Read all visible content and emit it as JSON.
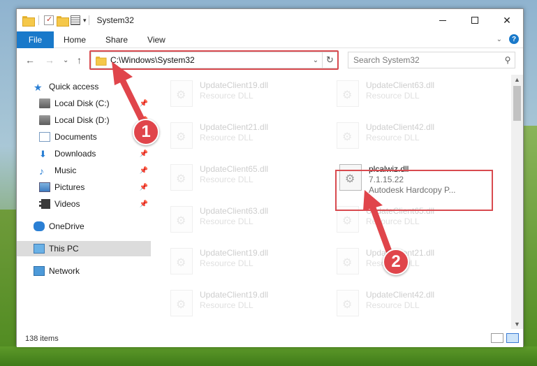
{
  "window": {
    "title": "System32"
  },
  "ribbon": {
    "tabs": [
      "File",
      "Home",
      "Share",
      "View"
    ]
  },
  "address": {
    "path": "C:\\Windows\\System32"
  },
  "search": {
    "placeholder": "Search System32"
  },
  "nav": {
    "items": [
      {
        "label": "Quick access",
        "icon": "star-icon"
      },
      {
        "label": "Local Disk (C:)",
        "icon": "disk-icon",
        "pinned": true
      },
      {
        "label": "Local Disk (D:)",
        "icon": "disk-icon",
        "pinned": true
      },
      {
        "label": "Documents",
        "icon": "documents-icon",
        "pinned": true
      },
      {
        "label": "Downloads",
        "icon": "downloads-icon",
        "pinned": true
      },
      {
        "label": "Music",
        "icon": "music-icon",
        "pinned": true
      },
      {
        "label": "Pictures",
        "icon": "pictures-icon",
        "pinned": true
      },
      {
        "label": "Videos",
        "icon": "videos-icon",
        "pinned": true
      },
      {
        "label": "OneDrive",
        "icon": "onedrive-icon"
      },
      {
        "label": "This PC",
        "icon": "this-pc-icon",
        "selected": true
      },
      {
        "label": "Network",
        "icon": "network-icon"
      }
    ]
  },
  "files": [
    {
      "name": "UpdateClient19.dll",
      "sub": "Resource DLL",
      "faded": true
    },
    {
      "name": "UpdateClient63.dll",
      "sub": "Resource DLL",
      "faded": true
    },
    {
      "name": "UpdateClient21.dll",
      "sub": "Resource DLL",
      "faded": true
    },
    {
      "name": "UpdateClient42.dll",
      "sub": "Resource DLL",
      "faded": true
    },
    {
      "name": "UpdateClient65.dll",
      "sub": "Resource DLL",
      "faded": true
    },
    {
      "name": "plcalwiz.dll",
      "sub": "7.1.15.22",
      "sub2": "Autodesk Hardcopy P...",
      "faded": false
    },
    {
      "name": "UpdateClient63.dll",
      "sub": "Resource DLL",
      "faded": true
    },
    {
      "name": "UpdateClient65.dll",
      "sub": "Resource DLL",
      "faded": true
    },
    {
      "name": "UpdateClient19.dll",
      "sub": "Resource DLL",
      "faded": true
    },
    {
      "name": "UpdateClient21.dll",
      "sub": "Resource DLL",
      "faded": true
    },
    {
      "name": "UpdateClient19.dll",
      "sub": "Resource DLL",
      "faded": true
    },
    {
      "name": "UpdateClient42.dll",
      "sub": "Resource DLL",
      "faded": true
    }
  ],
  "status": {
    "item_count": "138 items"
  },
  "annotations": {
    "step1": "1",
    "step2": "2",
    "color": "#e0454b"
  }
}
